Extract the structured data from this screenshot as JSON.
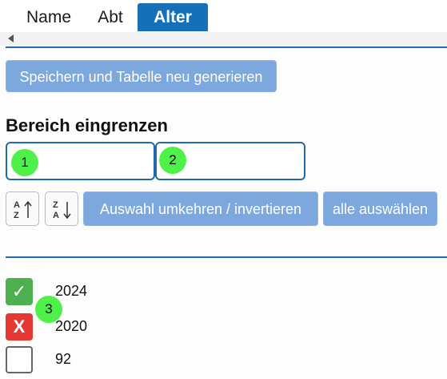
{
  "tabs": [
    {
      "label": "Name"
    },
    {
      "label": "Abt"
    },
    {
      "label": "Alter",
      "active": true
    }
  ],
  "toolbar": {
    "save_label": "Speichern und Tabelle neu generieren"
  },
  "range": {
    "heading": "Bereich eingrenzen",
    "from_value": "",
    "to_value": ""
  },
  "markers": [
    "1",
    "2",
    "3"
  ],
  "sort": {
    "asc": {
      "top": "A",
      "bottom": "Z"
    },
    "desc": {
      "top": "Z",
      "bottom": "A"
    }
  },
  "actions": {
    "invert_label": "Auswahl umkehren / invertieren",
    "select_all_label": "alle auswählen"
  },
  "values": [
    {
      "label": "2024",
      "state": "checked",
      "symbol": "✓"
    },
    {
      "label": "2020",
      "state": "rejected",
      "symbol": "X"
    },
    {
      "label": "92",
      "state": "empty",
      "symbol": ""
    }
  ],
  "colors": {
    "accent": "#1570b8",
    "button": "#7ca8dd",
    "checked": "#4caf50",
    "rejected": "#e53935",
    "marker": "#4ef04a"
  }
}
